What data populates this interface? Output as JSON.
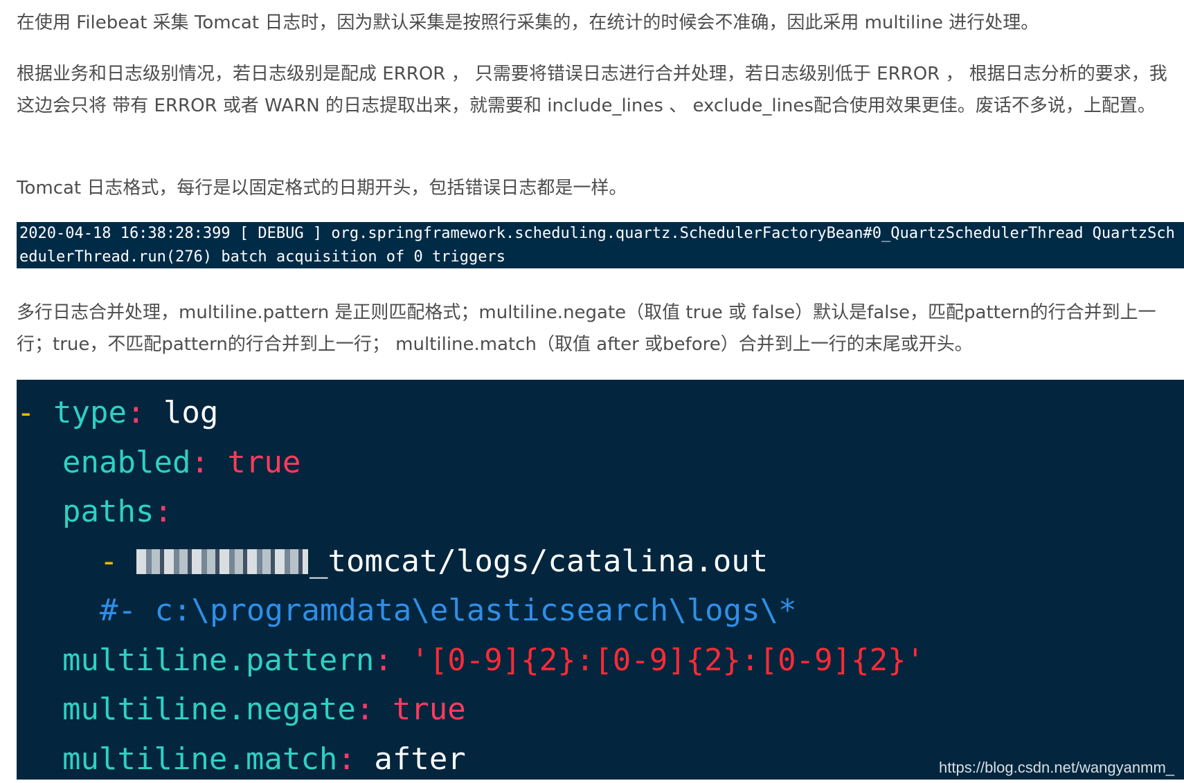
{
  "paragraphs": {
    "p1": "在使用 Filebeat 采集 Tomcat 日志时，因为默认采集是按照行采集的，在统计的时候会不准确，因此采用 multiline 进行处理。",
    "p2": "根据业务和日志级别情况，若日志级别是配成 ERROR ， 只需要将错误日志进行合并处理，若日志级别低于 ERROR ， 根据日志分析的要求，我这边会只将 带有 ERROR 或者 WARN 的日志提取出来，就需要和 include_lines 、 exclude_lines配合使用效果更佳。废话不多说，上配置。",
    "p3": "Tomcat 日志格式，每行是以固定格式的日期开头，包括错误日志都是一样。",
    "p4": "多行日志合并处理，multiline.pattern 是正则匹配格式；multiline.negate（取值 true 或 false）默认是false，匹配pattern的行合并到上一行；true，不匹配pattern的行合并到上一行； multiline.match（取值 after 或before）合并到上一行的末尾或开头。"
  },
  "log_sample": "2020-04-18 16:38:28:399 [ DEBUG ] org.springframework.scheduling.quartz.SchedulerFactoryBean#0_QuartzSchedulerThread QuartzSchedulerThread.run(276) batch acquisition of 0 triggers",
  "config": {
    "line1": {
      "dash": "- ",
      "key": "type",
      "colon": ": ",
      "value": "log"
    },
    "line2": {
      "key": "enabled",
      "colon": ": ",
      "value": "true"
    },
    "line3": {
      "key": "paths",
      "colon": ":"
    },
    "line4": {
      "dash": "- ",
      "value": "_tomcat/logs/catalina.out"
    },
    "line5": {
      "comment": "#- c:\\programdata\\elasticsearch\\logs\\*"
    },
    "line6": {
      "key": "multiline.pattern",
      "colon": ": ",
      "value": "'[0-9]{2}:[0-9]{2}:[0-9]{2}'"
    },
    "line7": {
      "key": "multiline.negate",
      "colon": ": ",
      "value": "true"
    },
    "line8": {
      "key": "multiline.match",
      "colon": ": ",
      "value": "after"
    }
  },
  "watermark": "https://blog.csdn.net/wangyanmm_",
  "colors": {
    "code_bg": "#03263e",
    "log_bg": "#002b47",
    "key": "#2fd0c3",
    "colon": "#ff3b6b",
    "bool": "#ff3b5c",
    "string": "#ff2a36",
    "comment": "#2f8fe8",
    "dash": "#f5b800",
    "text": "#4d4d4d"
  }
}
